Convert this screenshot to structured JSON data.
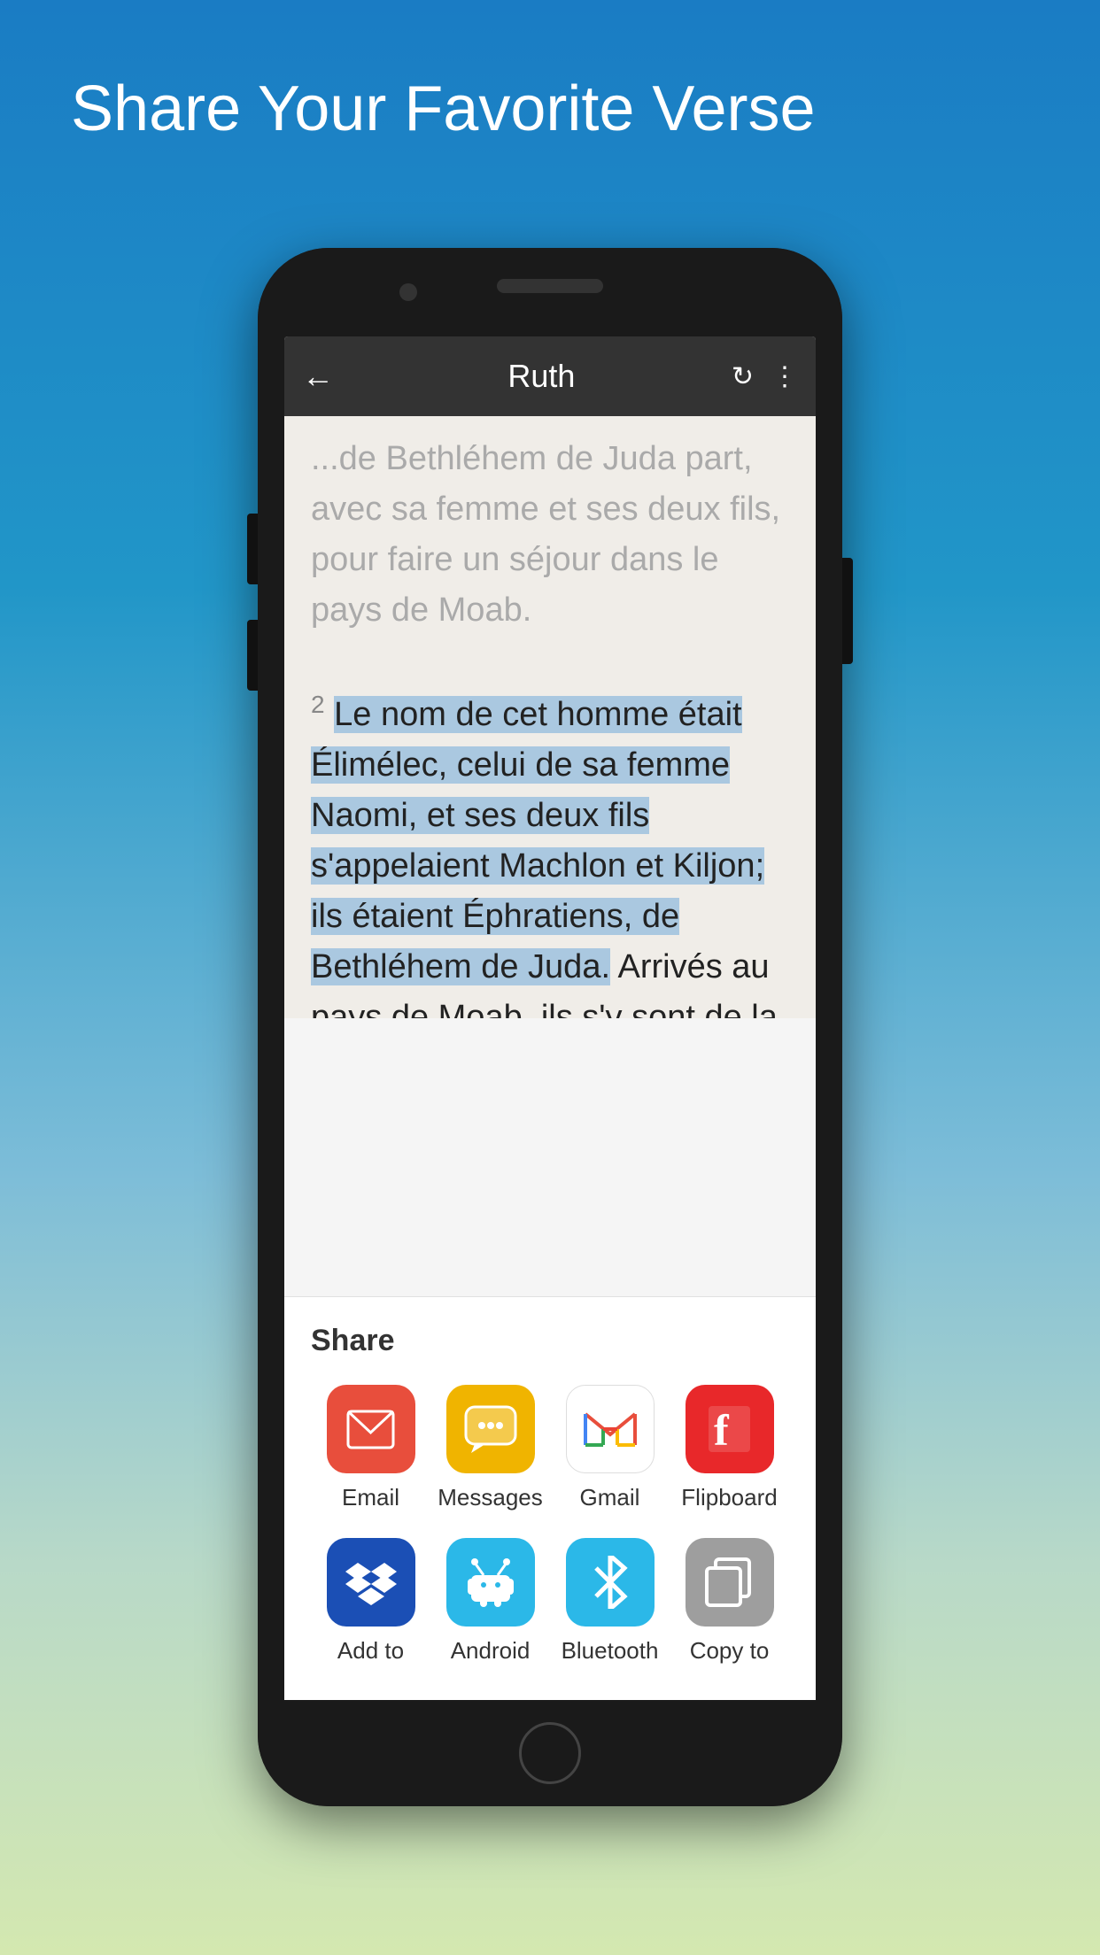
{
  "page": {
    "title": "Share Your Favorite Verse",
    "background_gradient_start": "#1a7cc4",
    "background_gradient_end": "#d4e8b0"
  },
  "toolbar": {
    "back_label": "←",
    "title": "Ruth",
    "refresh_icon": "↻",
    "more_icon": "⋮"
  },
  "bible": {
    "verse_partial": "...de Juda part, avec sa femme et ses deux fils, pour faire un séjour dans le pays de Moab.",
    "verse2_number": "2",
    "verse2_text_highlighted": "Le nom de cet homme était Élimélec, celui de sa femme Naomi, et ses deux fils s'appelaient Machlon et Kiljon; ils étaient Éphratiens, de Bethléhem de Juda.",
    "verse2_text_normal": " Arrivés au pays de Moab, ils s'y sont de la de..."
  },
  "share_panel": {
    "title": "Share",
    "row1": [
      {
        "id": "email",
        "label": "Email",
        "icon": "✉",
        "icon_class": "icon-email"
      },
      {
        "id": "messages",
        "label": "Messages",
        "icon": "💬",
        "icon_class": "icon-messages"
      },
      {
        "id": "gmail",
        "label": "Gmail",
        "icon": "M",
        "icon_class": "icon-gmail"
      },
      {
        "id": "flipboard",
        "label": "Flipboard",
        "icon": "f",
        "icon_class": "icon-flipboard"
      }
    ],
    "row2": [
      {
        "id": "dropbox",
        "label": "Add to",
        "icon": "◈",
        "icon_class": "icon-dropbox"
      },
      {
        "id": "android",
        "label": "Android",
        "icon": "⊞",
        "icon_class": "icon-android"
      },
      {
        "id": "bluetooth",
        "label": "Bluetooth",
        "icon": "ʙ",
        "icon_class": "icon-bluetooth"
      },
      {
        "id": "copy",
        "label": "Copy to",
        "icon": "❐",
        "icon_class": "icon-copy"
      }
    ]
  }
}
